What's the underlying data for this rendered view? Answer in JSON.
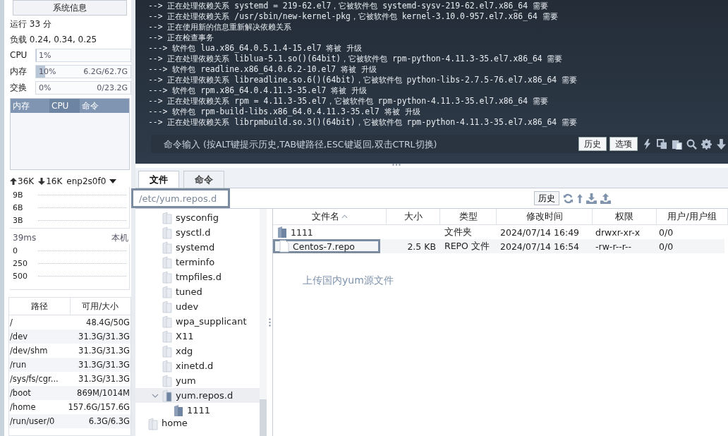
{
  "sidebar": {
    "title_button": "系统信息",
    "uptime": "运行 33 分",
    "load": "负载 0.24, 0.34, 0.25",
    "meters": [
      {
        "label": "CPU",
        "percent": "1%",
        "level": 0.01
      },
      {
        "label": "内存",
        "percent": "10%",
        "reading": "6.2G/62.7G",
        "level": 0.1
      },
      {
        "label": "交换",
        "percent": "0%",
        "reading": "0/23.2G"
      }
    ],
    "process_columns": [
      {
        "label": "内存",
        "selected": false
      },
      {
        "label": "CPU",
        "selected": true
      },
      {
        "label": "命令",
        "selected": false
      }
    ],
    "network": {
      "up": "36K",
      "down": "16K",
      "interface": "enp2s0f0",
      "axis": [
        "9B",
        "6B",
        "3B"
      ]
    },
    "ping": {
      "latency": "39ms",
      "target": "本机",
      "axis": [
        "0",
        "250",
        "500"
      ]
    },
    "disk_columns": [
      "路径",
      "可用/大小"
    ],
    "disks": [
      {
        "path": "/",
        "size": "48.4G/50G"
      },
      {
        "path": "/dev",
        "size": "31.3G/31.3G"
      },
      {
        "path": "/dev/shm",
        "size": "31.3G/31.3G"
      },
      {
        "path": "/run",
        "size": "31.3G/31.3G"
      },
      {
        "path": "/sys/fs/cgr...",
        "size": "31.3G/31.3G"
      },
      {
        "path": "/boot",
        "size": "869M/1014M"
      },
      {
        "path": "/home",
        "size": "157.6G/157.6G"
      },
      {
        "path": "/run/user/0",
        "size": "6.3G/6.3G"
      }
    ]
  },
  "terminal": {
    "lines": [
      "--> 正在处理依赖关系 systemd = 219-62.el7，它被软件包 systemd-sysv-219-62.el7.x86_64 需要",
      "--> 正在处理依赖关系 /usr/sbin/new-kernel-pkg，它被软件包 kernel-3.10.0-957.el7.x86_64 需要",
      "--> 正在使用新的信息重新解决依赖关系",
      "--> 正在检查事务",
      "---> 软件包 lua.x86_64.0.5.1.4-15.el7 将被 升级",
      "--> 正在处理依赖关系 liblua-5.1.so()(64bit)，它被软件包 rpm-python-4.11.3-35.el7.x86_64 需要",
      "---> 软件包 readline.x86_64.0.6.2-10.el7 将被 升级",
      "--> 正在处理依赖关系 libreadline.so.6()(64bit)，它被软件包 python-libs-2.7.5-76.el7.x86_64 需要",
      "---> 软件包 rpm.x86_64.0.4.11.3-35.el7 将被 升级",
      "--> 正在处理依赖关系 rpm = 4.11.3-35.el7，它被软件包 rpm-python-4.11.3-35.el7.x86_64 需要",
      "---> 软件包 rpm-build-libs.x86_64.0.4.11.3-35.el7 将被 升级",
      "--> 正在处理依赖关系 librpmbuild.so.3()(64bit)，它被软件包 rpm-python-4.11.3-35.el7.x86_64 需要"
    ],
    "command_input": {
      "placeholder": "命令输入 (按ALT键提示历史,TAB键路径,ESC键返回,双击CTRL切换)"
    },
    "buttons": [
      "历史",
      "选项"
    ]
  },
  "file_manager": {
    "tabs": [
      {
        "label": "文件",
        "selected": true
      },
      {
        "label": "命令",
        "selected": false
      }
    ],
    "path": {
      "value": "/etc/yum.repos.d",
      "highlighted": true
    },
    "history_button": "历史",
    "tree": {
      "items": [
        {
          "label": "sysconfig",
          "selected": false
        },
        {
          "label": "sysctl.d",
          "selected": false
        },
        {
          "label": "systemd",
          "selected": false
        },
        {
          "label": "terminfo",
          "selected": false
        },
        {
          "label": "tmpfiles.d",
          "selected": false
        },
        {
          "label": "tuned",
          "selected": false
        },
        {
          "label": "udev",
          "selected": false
        },
        {
          "label": "wpa_supplicant",
          "selected": false
        },
        {
          "label": "X11",
          "selected": false
        },
        {
          "label": "xdg",
          "selected": false
        },
        {
          "label": "xinetd.d",
          "selected": false
        },
        {
          "label": "yum",
          "selected": false
        },
        {
          "label": "yum.repos.d",
          "selected": true,
          "expanded": true,
          "children": [
            {
              "label": "1111",
              "selected": false
            }
          ]
        }
      ],
      "next_top_level": {
        "label": "home",
        "selected": false
      }
    },
    "columns": [
      "文件名",
      "大小",
      "类型",
      "修改时间",
      "权限",
      "用户/用户组"
    ],
    "files": [
      {
        "kind": "folder",
        "name": "1111",
        "type": "文件夹",
        "modified": "2024/07/14 16:49",
        "permissions": "drwxr-xr-x",
        "owner": "0/0",
        "highlighted": false
      },
      {
        "kind": "file",
        "name": "Centos-7.repo",
        "size": "2.5 KB",
        "type": "REPO 文件",
        "modified": "2024/07/14 16:54",
        "permissions": "-rw-r--r--",
        "owner": "0/0",
        "highlighted": true
      }
    ],
    "note": "上传国内yum源文件"
  }
}
